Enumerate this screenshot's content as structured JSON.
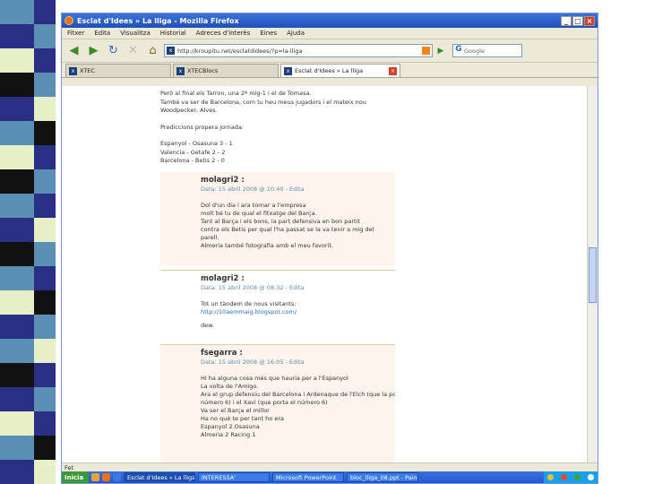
{
  "window": {
    "title": "Esclat d'Idees » La lliga - Mozilla Firefox",
    "btn_min": "_",
    "btn_max": "□",
    "btn_close": "×"
  },
  "menu": [
    "Fitxer",
    "Edita",
    "Visualitza",
    "Historial",
    "Adreces d'interès",
    "Eines",
    "Ajuda"
  ],
  "nav": {
    "url": "http://kroupitu.net/esclatdidees/?p=la-lliga",
    "search_placeholder": "Google",
    "search_logo": "G",
    "back_icon": "◀",
    "forward_icon": "▶",
    "reload_icon": "↻",
    "stop_icon": "✕",
    "home_icon": "⌂",
    "go_icon": "▶"
  },
  "tabs": [
    {
      "label": "XTEC",
      "close": "×"
    },
    {
      "label": "XTECBlocs",
      "close": "×"
    },
    {
      "label": "Esclat d'Idees » La lliga",
      "close": "×"
    }
  ],
  "article": {
    "lines": [
      "Però al final els Tarron, una 2ª mig-1 i el de Tomasa.",
      "També va ser de Barcelona, com tu heu meus jugadors i el mateix nou",
      "Woodpecker, Alves."
    ],
    "section": "Prediccions propera jornada:",
    "results": [
      "Espanyol - Osasuna 3 - 1",
      "Valencia - Getafe 2 - 2",
      "Barcelona - Betis 2 - 0"
    ]
  },
  "comments": [
    {
      "author": "molagri2 :",
      "date": "Data: 15 abril 2008 @ 10:40 - Edita",
      "lines": [
        "Dol d'un dia i ara tornar a l'empresa",
        "molt bé tu de qual el fitxatge del Barça.",
        "Tant al Barça i els bons, la part defensiva en bon partit",
        "contra els Betis per qual l'ha passat se la va tenir a mig del",
        "parell.",
        "Almeria també fotografia amb el meu favorit."
      ]
    },
    {
      "author": "molagri2 :",
      "date": "Data: 15 abril 2008 @ 08:32 - Edita",
      "lines": [
        "Tot un tàndem de nous visitants:",
        "http://10aemmaig.blogspot.com/"
      ],
      "sign": "dew."
    },
    {
      "author": "fsegarra :",
      "date": "Data: 15 abril 2008 @ 16:05 - Edita",
      "lines": [
        "Hi ha alguna cosa més que hauria per a l'Espanyol",
        "La volta de l'Amigo.",
        "Ara el grup defensiu del Barcelona i Ardenaque de l'Elch (que la portava el",
        "número 6) i el Xavi (que porta el número 6)",
        "Va ser el Barça el millor",
        "Ha no què te per tant ho era",
        "Espanyol 2 Osasuna",
        "Almeria 2 Racing 1"
      ]
    }
  ],
  "status": "Fet",
  "taskbar": {
    "start": "Inicia",
    "items": [
      "Esclat d'Idees » La lliga",
      "INTERESSA'",
      "Microsoft PowerPoint",
      "bloc_lliga_08.ppt - Paint"
    ]
  }
}
